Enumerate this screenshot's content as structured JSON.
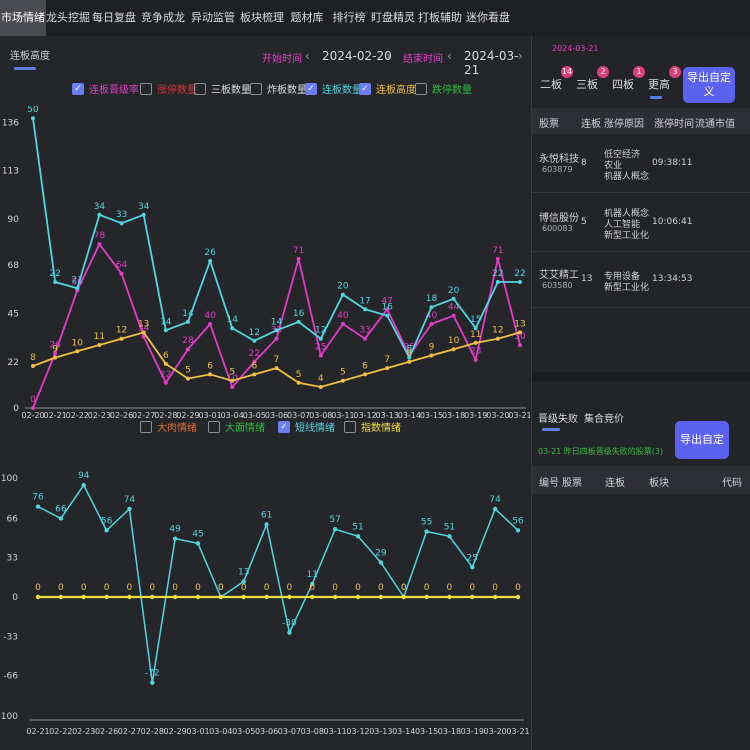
{
  "tabs": [
    "市场情绪",
    "龙头挖掘",
    "每日复盘",
    "竞争成龙",
    "异动监管",
    "板块梳理",
    "题材库",
    "排行榜",
    "盯盘精灵",
    "打板辅助",
    "迷你看盘"
  ],
  "active_tab": 0,
  "left": {
    "subtab": "连板高度",
    "start_label": "开始时间",
    "start_date": "2024-02-20",
    "end_label": "结束时间",
    "end_date": "2024-03-21",
    "prev_arrow": "‹",
    "next_arrow": "›",
    "legend1": [
      {
        "label": "连板晋级率",
        "checked": true,
        "color": "#e23cc8"
      },
      {
        "label": "涨停数量",
        "checked": false,
        "color": "#e0302c"
      },
      {
        "label": "三板数量",
        "checked": false,
        "color": "#d8dbe0"
      },
      {
        "label": "炸板数量",
        "checked": false,
        "color": "#d8dbe0"
      },
      {
        "label": "连板数量",
        "checked": true,
        "color": "#4fd6e0"
      },
      {
        "label": "连板高度",
        "checked": true,
        "color": "#f0c040"
      },
      {
        "label": "跌停数量",
        "checked": false,
        "color": "#2dbb3c"
      }
    ],
    "legend2": [
      {
        "label": "大肉情绪",
        "checked": false,
        "color": "#e06a2c"
      },
      {
        "label": "大面情绪",
        "checked": false,
        "color": "#2dbb3c"
      },
      {
        "label": "短线情绪",
        "checked": true,
        "color": "#4fd6e0"
      },
      {
        "label": "指数情绪",
        "checked": false,
        "color": "#f0e040"
      }
    ]
  },
  "chart_data": [
    {
      "type": "line",
      "categories": [
        "02-20",
        "02-21",
        "02-22",
        "02-23",
        "02-26",
        "02-27",
        "02-28",
        "02-29",
        "03-01",
        "03-04",
        "03-05",
        "03-06",
        "03-07",
        "03-08",
        "03-11",
        "03-12",
        "03-13",
        "03-14",
        "03-15",
        "03-18",
        "03-19",
        "03-20",
        "03-21"
      ],
      "yticks": [
        0,
        22,
        45,
        68,
        90,
        113,
        136
      ],
      "ylim": [
        0,
        140
      ],
      "series": [
        {
          "name": "连板晋级率",
          "color": "#e23cc8",
          "values": [
            0,
            26,
            56,
            78,
            64,
            34,
            12,
            28,
            40,
            10,
            22,
            33,
            71,
            25,
            40,
            33,
            47,
            25,
            40,
            44,
            23,
            71,
            30
          ],
          "labels": [
            0,
            26,
            56,
            78,
            64,
            34,
            12,
            28,
            40,
            10,
            22,
            33,
            71,
            25,
            40,
            33,
            47,
            25,
            40,
            44,
            23,
            71,
            30
          ]
        },
        {
          "name": "连板数量",
          "color": "#4fd6e0",
          "values": [
            138,
            60,
            57,
            92,
            88,
            92,
            37,
            41,
            70,
            38,
            32,
            37,
            41,
            33,
            54,
            47,
            44,
            24,
            48,
            52,
            38,
            60,
            60
          ],
          "labels": [
            50,
            22,
            21,
            34,
            33,
            34,
            14,
            14,
            26,
            14,
            12,
            14,
            16,
            12,
            20,
            17,
            16,
            8,
            18,
            20,
            15,
            22,
            22
          ]
        },
        {
          "name": "连板高度",
          "color": "#f0c040",
          "values": [
            20,
            24,
            27,
            30,
            33,
            36,
            21,
            14,
            16,
            13,
            16,
            19,
            12,
            10,
            13,
            16,
            19,
            22,
            25,
            28,
            31,
            33,
            36
          ],
          "labels": [
            8,
            9,
            10,
            11,
            12,
            13,
            6,
            5,
            6,
            5,
            6,
            7,
            5,
            4,
            5,
            6,
            7,
            8,
            9,
            10,
            11,
            12,
            13
          ]
        }
      ]
    },
    {
      "type": "line",
      "categories": [
        "02-21",
        "02-22",
        "02-23",
        "02-26",
        "02-27",
        "02-28",
        "02-29",
        "03-01",
        "03-04",
        "03-05",
        "03-06",
        "03-07",
        "03-08",
        "03-11",
        "03-12",
        "03-13",
        "03-14",
        "03-15",
        "03-18",
        "03-19",
        "03-20",
        "03-21"
      ],
      "yticks": [
        100,
        66,
        33,
        0,
        -33,
        -66,
        -100
      ],
      "ylim": [
        -100,
        100
      ],
      "series": [
        {
          "name": "短线情绪",
          "color": "#4fd6e0",
          "values": [
            76,
            66,
            94,
            56,
            74,
            -72,
            49,
            45,
            0,
            13,
            61,
            -30,
            11,
            57,
            51,
            29,
            0,
            55,
            51,
            25,
            74,
            56
          ]
        },
        {
          "name": "指数情绪",
          "color": "#e8e040",
          "values": [
            0,
            0,
            0,
            0,
            0,
            0,
            0,
            0,
            0,
            0,
            0,
            0,
            0,
            0,
            0,
            0,
            0,
            0,
            0,
            0,
            0,
            0
          ]
        }
      ]
    }
  ],
  "right": {
    "date_top": "2024-03-21",
    "mini_tabs": [
      {
        "label": "二板",
        "badge": "14"
      },
      {
        "label": "三板",
        "badge": "2"
      },
      {
        "label": "四板",
        "badge": "1"
      },
      {
        "label": "更高",
        "badge": "3"
      }
    ],
    "export_label": "导出自定义",
    "table_headers": [
      "股票",
      "连板",
      "涨停原因",
      "涨停时间",
      "流通市值"
    ],
    "rows": [
      {
        "name": "永悦科技",
        "code": "603879",
        "boards": "8",
        "reasons": [
          "低空经济",
          "农业",
          "机器人概念"
        ],
        "time": "09:38:11"
      },
      {
        "name": "博信股份",
        "code": "600083",
        "boards": "5",
        "reasons": [
          "机器人概念",
          "人工智能",
          "新型工业化"
        ],
        "time": "10:06:41"
      },
      {
        "name": "艾艾精工",
        "code": "603580",
        "boards": "13",
        "reasons": [
          "专用设备",
          "新型工业化"
        ],
        "time": "13:34:53"
      }
    ],
    "section2_tab1": "晋级失败",
    "section2_tab2": "集合竞价",
    "section2_export": "导出自定义",
    "section2_note": "03-21 昨日四板晋级失败的股票(3)",
    "section2_headers": [
      "编号",
      "股票",
      "连板",
      "板块",
      "代码"
    ]
  }
}
